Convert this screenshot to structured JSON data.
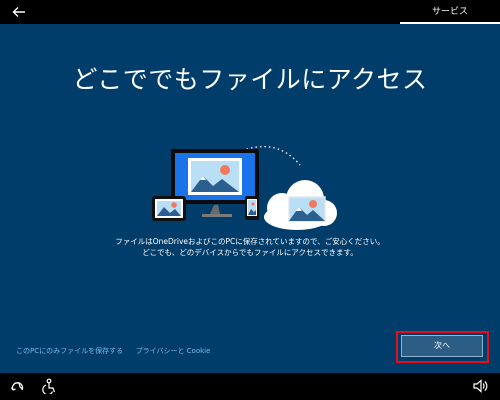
{
  "header": {
    "tab_label": "サービス"
  },
  "main": {
    "title": "どこででもファイルにアクセス",
    "description_line1": "ファイルはOneDriveおよびこのPCに保存されていますので、ご安心ください。",
    "description_line2": "どこでも、どのデバイスからでもファイルにアクセスできます。"
  },
  "footer_links": {
    "save_local": "このPCにのみファイルを保存する",
    "privacy": "プライバシーと Cookie"
  },
  "actions": {
    "next_label": "次へ"
  },
  "bottom_bar": {
    "icons": [
      "ease-of-access-icon",
      "accessibility-icon",
      "volume-icon"
    ]
  },
  "colors": {
    "background": "#003d6b",
    "accent_link": "#7ab8f0",
    "highlight": "#e3101c"
  }
}
